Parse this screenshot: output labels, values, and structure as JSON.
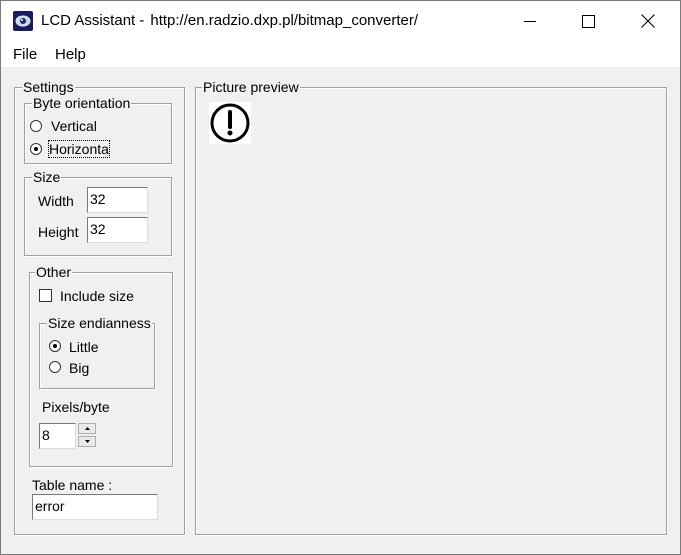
{
  "window": {
    "app_name": "LCD Assistant -",
    "url": "http://en.radzio.dxp.pl/bitmap_converter/"
  },
  "menu": {
    "file": "File",
    "help": "Help"
  },
  "settings": {
    "legend": "Settings",
    "byte_orientation": {
      "legend": "Byte orientation",
      "vertical": "Vertical",
      "horizontal": "Horizonta",
      "selected": "horizontal"
    },
    "size": {
      "legend": "Size",
      "width_label": "Width",
      "width_value": "32",
      "height_label": "Height",
      "height_value": "32"
    },
    "other": {
      "legend": "Other",
      "include_size_label": "Include size",
      "include_size_checked": false,
      "endianness": {
        "legend": "Size endianness",
        "little": "Little",
        "big": "Big",
        "selected": "little"
      },
      "pixels_per_byte_label": "Pixels/byte",
      "pixels_per_byte_value": "8"
    },
    "table_name_label": "Table name :",
    "table_name_value": "error"
  },
  "preview": {
    "legend": "Picture preview",
    "icon": "exclamation-circle-icon"
  }
}
